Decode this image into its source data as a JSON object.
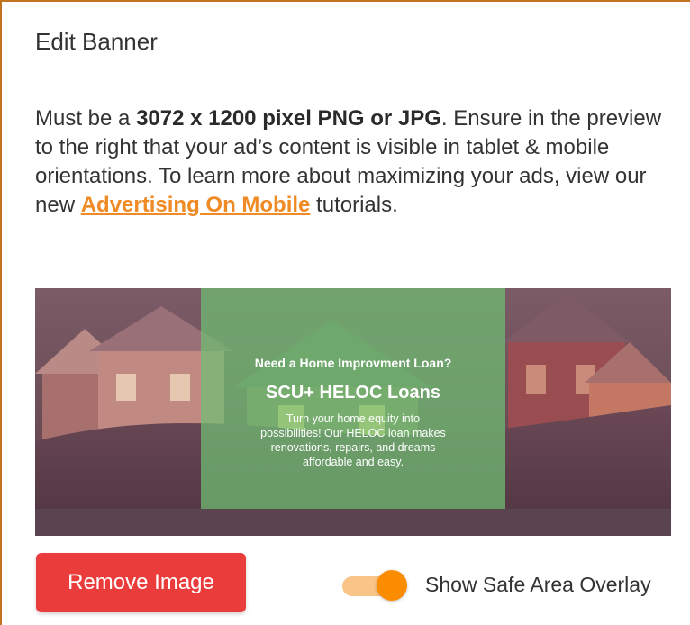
{
  "header": {
    "title": "Edit Banner"
  },
  "description": {
    "part1": "Must be a ",
    "requirement": "3072 x 1200 pixel PNG or JPG",
    "part2": ". Ensure in the preview to the right that your ad’s content is visible in tablet & mobile orientations. To learn more about maximizing your ads, view our new ",
    "link_text": "Advertising On Mobile",
    "part3": " tutorials."
  },
  "banner": {
    "headline": "Need a Home Improvment Loan?",
    "title": "SCU+ HELOC Loans",
    "body_line1": "Turn your home equity into",
    "body_line2": "possibilities! Our HELOC loan makes",
    "body_line3": "renovations, repairs, and dreams",
    "body_line4": "affordable and easy."
  },
  "actions": {
    "remove_label": "Remove Image",
    "overlay_toggle_label": "Show Safe Area Overlay",
    "overlay_toggle_on": true
  },
  "colors": {
    "border_accent": "#c0741f",
    "link": "#f08a24",
    "remove_button": "#ea3c3a",
    "toggle_knob": "#fb8c00",
    "toggle_track": "#f8c487",
    "safe_area_overlay": "#6fbf73",
    "outer_overlay": "#8a5a6a"
  }
}
